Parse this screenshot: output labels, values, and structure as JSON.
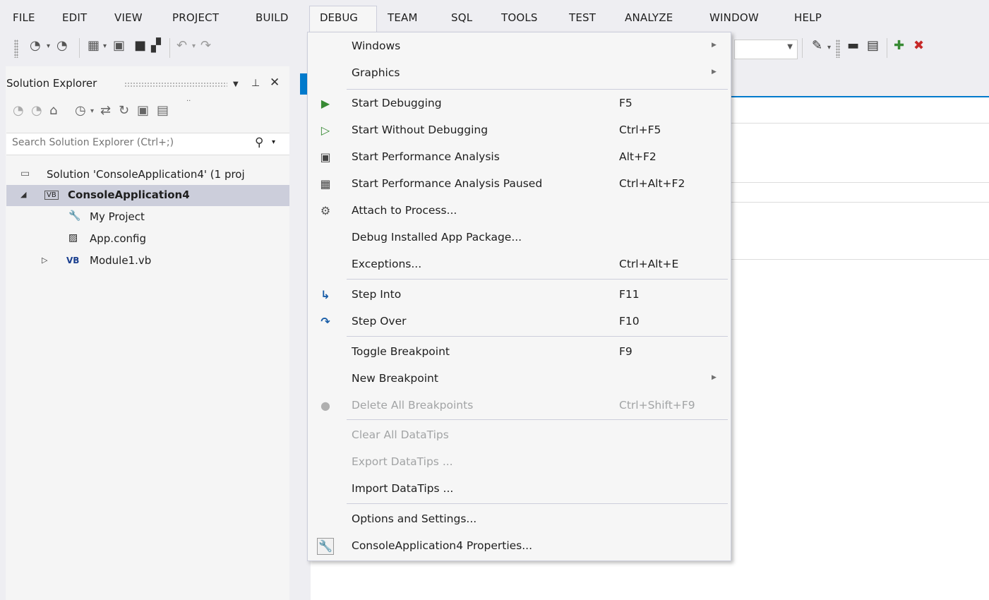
{
  "menubar": {
    "items": [
      {
        "label": "FILE"
      },
      {
        "label": "EDIT"
      },
      {
        "label": "VIEW"
      },
      {
        "label": "PROJECT"
      },
      {
        "label": "BUILD"
      },
      {
        "label": "DEBUG"
      },
      {
        "label": "TEAM"
      },
      {
        "label": "SQL"
      },
      {
        "label": "TOOLS"
      },
      {
        "label": "TEST"
      },
      {
        "label": "ANALYZE"
      },
      {
        "label": "WINDOW"
      },
      {
        "label": "HELP"
      }
    ]
  },
  "solution_explorer": {
    "title": "Solution Explorer",
    "search_placeholder": "Search Solution Explorer (Ctrl+;)",
    "tree": [
      {
        "label": "Solution 'ConsoleApplication4' (1 proj"
      },
      {
        "label": "ConsoleApplication4"
      },
      {
        "label": "My Project"
      },
      {
        "label": "App.config"
      },
      {
        "label": "Module1.vb"
      }
    ],
    "vb_badge": "VB"
  },
  "debug_menu": {
    "items": [
      {
        "label": "Windows",
        "shortcut": ""
      },
      {
        "label": "Graphics",
        "shortcut": ""
      },
      {
        "label": "Start Debugging",
        "shortcut": "F5"
      },
      {
        "label": "Start Without Debugging",
        "shortcut": "Ctrl+F5"
      },
      {
        "label": "Start Performance Analysis",
        "shortcut": "Alt+F2"
      },
      {
        "label": "Start Performance Analysis Paused",
        "shortcut": "Ctrl+Alt+F2"
      },
      {
        "label": "Attach to Process...",
        "shortcut": ""
      },
      {
        "label": "Debug Installed App Package...",
        "shortcut": ""
      },
      {
        "label": "Exceptions...",
        "shortcut": "Ctrl+Alt+E"
      },
      {
        "label": "Step Into",
        "shortcut": "F11"
      },
      {
        "label": "Step Over",
        "shortcut": "F10"
      },
      {
        "label": "Toggle Breakpoint",
        "shortcut": "F9"
      },
      {
        "label": "New Breakpoint",
        "shortcut": ""
      },
      {
        "label": "Delete All Breakpoints",
        "shortcut": "Ctrl+Shift+F9"
      },
      {
        "label": "Clear All DataTips",
        "shortcut": ""
      },
      {
        "label": "Export DataTips ...",
        "shortcut": ""
      },
      {
        "label": "Import DataTips ...",
        "shortcut": ""
      },
      {
        "label": "Options and Settings...",
        "shortcut": ""
      },
      {
        "label": "ConsoleApplication4 Properties...",
        "shortcut": ""
      }
    ]
  },
  "colors": {
    "accent": "#007acc",
    "play_green": "#388a34",
    "disabled_text": "#a2a4a5",
    "menu_bg": "#f6f6f6",
    "selection": "#cccedb"
  }
}
